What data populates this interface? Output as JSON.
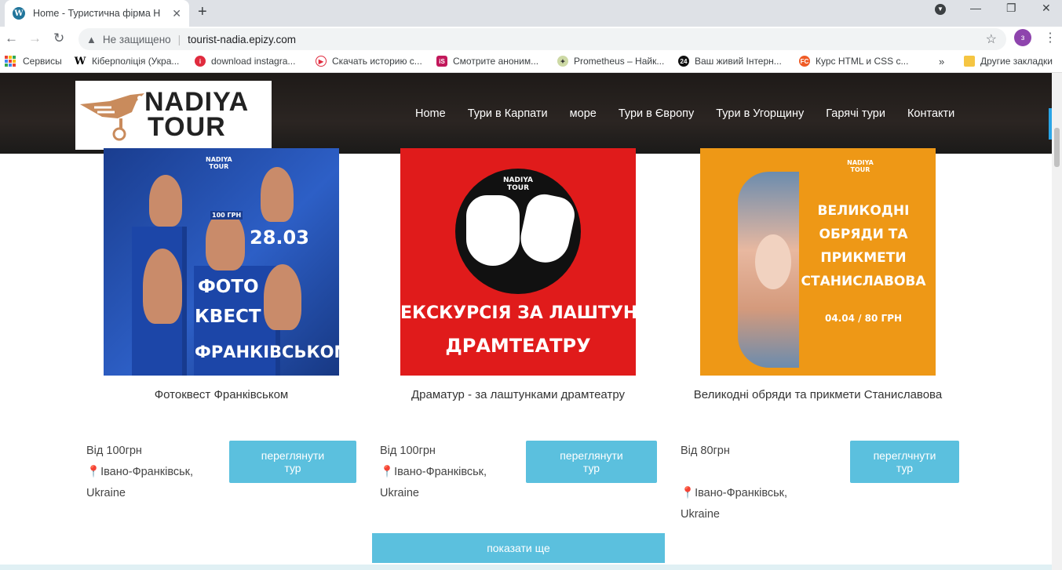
{
  "browser": {
    "tab_title": "Home - Туристична фірма Н",
    "address_status": "Не защищено",
    "url": "tourist-nadia.epizy.com",
    "profile_initial": "з",
    "bookmarks": [
      "Сервисы",
      "Кіберполіція (Укра...",
      "download instagra...",
      "Скачать историю с...",
      "Смотрите аноним...",
      "Prometheus – Найк...",
      "Ваш живий Інтерн...",
      "Курс HTML и CSS с..."
    ],
    "other_bookmarks": "Другие закладки"
  },
  "site": {
    "logo_line1": "NADIYA",
    "logo_line2": "TOUR",
    "menu": [
      "Home",
      "Тури в Карпати",
      "море",
      "Тури в Європу",
      "Тури в Угорщину",
      "Гарячі тури",
      "Контакти"
    ],
    "cards": [
      {
        "title": "Фотоквест Франківськом",
        "price": "Від 100грн",
        "location_line1": "Івано-Франківськ,",
        "location_line2": "Ukraine",
        "button": "переглянути тур",
        "image_text": {
          "brand1": "NADIYA",
          "brand2": "TOUR",
          "badge": "100 ГРН",
          "date": "28.03",
          "l1": "ФОТО",
          "l2": "КВЕСТ",
          "l3": "ФРАНКІВСЬКОМ"
        }
      },
      {
        "title": "Драматур - за лаштунками драмтеатру",
        "price": "Від 100грн",
        "location_line1": "Івано-Франківськ,",
        "location_line2": "Ukraine",
        "button": "переглянути тур",
        "image_text": {
          "brand1": "NADIYA",
          "brand2": "TOUR",
          "l1": "ЕКСКУРСІЯ ЗА ЛАШТУНКИ",
          "l2": "ДРАМТЕАТРУ"
        }
      },
      {
        "title": "Великодні обряди та прикмети Станиславова",
        "price": "Від 80грн",
        "location_line1": "Івано-Франківськ,",
        "location_line2": "Ukraine",
        "button": "переглчнути тур",
        "image_text": {
          "brand1": "NADIYA",
          "brand2": "TOUR",
          "l1": "ВЕЛИКОДНІ",
          "l2": "ОБРЯДИ ТА",
          "l3": "ПРИКМЕТИ",
          "l4": "СТАНИСЛАВОВА",
          "l5": "04.04 / 80 ГРН"
        }
      }
    ],
    "show_more": "показати ще"
  },
  "colors": {
    "accent": "#5bc0de",
    "header": "#231f1d",
    "card2": "#e01b1b",
    "card3": "#ee9816",
    "card1": "#1f49b0"
  }
}
